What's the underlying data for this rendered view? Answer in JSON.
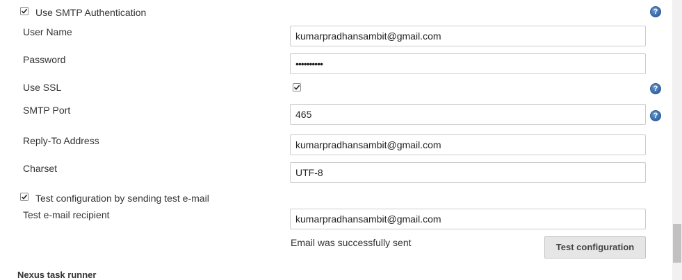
{
  "smtp_auth": {
    "label": "Use SMTP Authentication",
    "checked": true
  },
  "user_name": {
    "label": "User Name",
    "value": "kumarpradhansambit@gmail.com"
  },
  "password": {
    "label": "Password",
    "value": "••••••••••"
  },
  "use_ssl": {
    "label": "Use SSL",
    "checked": true
  },
  "smtp_port": {
    "label": "SMTP Port",
    "value": "465"
  },
  "reply_to": {
    "label": "Reply-To Address",
    "value": "kumarpradhansambit@gmail.com"
  },
  "charset": {
    "label": "Charset",
    "value": "UTF-8"
  },
  "test_config": {
    "label": "Test configuration by sending test e-mail",
    "checked": true
  },
  "test_recipient": {
    "label": "Test e-mail recipient",
    "value": "kumarpradhansambit@gmail.com"
  },
  "status_message": "Email was successfully sent",
  "test_button_label": "Test configuration",
  "next_section_title": "Nexus task runner",
  "help_glyph": "?",
  "icons": {
    "help": "help-icon",
    "check": "checkmark-icon"
  },
  "colors": {
    "help_icon": "#3b6eae",
    "button_bg": "#e6e6e6",
    "field_border": "#cccccc"
  }
}
